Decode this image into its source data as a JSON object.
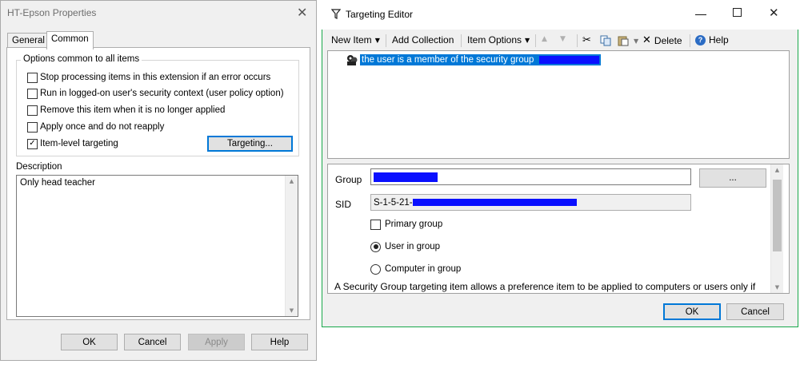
{
  "props_dialog": {
    "title": "HT-Epson Properties",
    "tabs": [
      {
        "label": "General"
      },
      {
        "label": "Common"
      }
    ],
    "group_label": "Options common to all items",
    "options": [
      {
        "label": "Stop processing items in this extension if an error occurs",
        "checked": false
      },
      {
        "label": "Run in logged-on user's security context (user policy option)",
        "checked": false
      },
      {
        "label": "Remove this item when it is no longer applied",
        "checked": false
      },
      {
        "label": "Apply once and do not reapply",
        "checked": false
      },
      {
        "label": "Item-level targeting",
        "checked": true
      }
    ],
    "targeting_button": "Targeting...",
    "description_label": "Description",
    "description_text": "Only head teacher",
    "buttons": {
      "ok": "OK",
      "cancel": "Cancel",
      "apply": "Apply",
      "help": "Help"
    }
  },
  "targeting_editor": {
    "title": "Targeting Editor",
    "toolbar": {
      "new_item": "New Item",
      "add_collection": "Add Collection",
      "item_options": "Item Options",
      "delete": "Delete",
      "help": "Help"
    },
    "tree_item": "the user is a member of the security group",
    "group_label": "Group",
    "browse_button": "...",
    "sid_label": "SID",
    "sid_prefix": "S-1-5-21-",
    "primary_group": {
      "label": "Primary group",
      "checked": false
    },
    "user_in_group": {
      "label": "User in group",
      "selected": true
    },
    "computer_in_group": {
      "label": "Computer in group",
      "selected": false
    },
    "help_text": "A Security Group targeting item allows a preference item to be applied to computers or users only if",
    "buttons": {
      "ok": "OK",
      "cancel": "Cancel"
    }
  },
  "colors": {
    "accent": "#0078d7",
    "redaction": "#0a10ff",
    "editor_border": "#18a74a"
  }
}
